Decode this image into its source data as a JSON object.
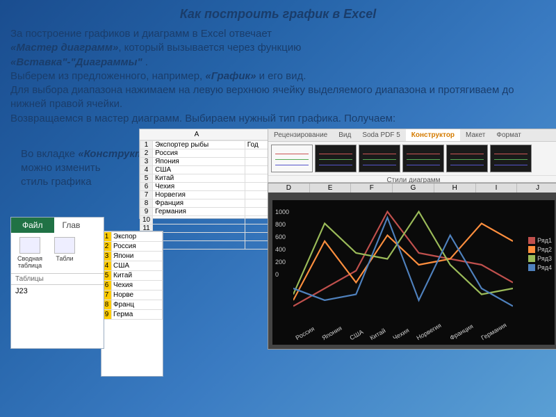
{
  "title": "Как построить график в Excel",
  "intro": {
    "p1_a": "За построение графиков и диаграмм в Excel отвечает",
    "p1_b": "«Мастер диаграмм»",
    "p1_c": ", который вызывается через функцию",
    "p2": "«Вставка\"-\"Диаграммы\"",
    "p2_dot": " .",
    "p3_a": "Выберем из предложенного, например, ",
    "p3_b": "«График»",
    "p3_c": " и его вид.",
    "p4": "Для выбора диапазона нажимаем на левую верхнюю ячейку выделяемого диапазона и протягиваем до нижней правой ячейки.",
    "p5": "Возвращаемся в мастер диаграмм. Выбираем нужный тип графика. Получаем:"
  },
  "overlay": {
    "a": "Во вкладке ",
    "b": "«Конструктор»",
    "c": "можно изменить",
    "d": "стиль графика"
  },
  "excel1": {
    "file": "Файл",
    "home": "Глав",
    "tool1": "Сводная таблица",
    "tool2": "Табли",
    "section": "Таблицы",
    "cell": "J23"
  },
  "excel2": {
    "hdr": "Экспор",
    "rows": [
      "Россия",
      "Япони",
      "США",
      "Китай",
      "Чехия",
      "Норве",
      "Франц",
      "Герма"
    ]
  },
  "excel3": {
    "colA_header": "A",
    "colA_label": "Экспортер рыбы",
    "colB_label": "Год",
    "rows": [
      "Россия",
      "Япония",
      "США",
      "Китай",
      "Чехия",
      "Норвегия",
      "Франция",
      "Германия"
    ]
  },
  "ribbon": {
    "tabs": [
      "Рецензирование",
      "Вид",
      "Soda PDF 5",
      "Конструктор",
      "Макет",
      "Формат"
    ],
    "caption": "Стили диаграмм"
  },
  "chart_data": {
    "type": "line",
    "categories": [
      "Россия",
      "Япония",
      "США",
      "Китай",
      "Чехия",
      "Норвегия",
      "Франция",
      "Германия"
    ],
    "series": [
      {
        "name": "Ряд1",
        "color": "#c0504d",
        "values": [
          150,
          300,
          450,
          950,
          600,
          550,
          500,
          350
        ]
      },
      {
        "name": "Ряд2",
        "color": "#ff8f3e",
        "values": [
          200,
          700,
          350,
          750,
          500,
          550,
          850,
          700
        ]
      },
      {
        "name": "Ряд3",
        "color": "#9bbb59",
        "values": [
          250,
          850,
          600,
          550,
          950,
          500,
          250,
          300
        ]
      },
      {
        "name": "Ряд4",
        "color": "#4f81bd",
        "values": [
          300,
          200,
          250,
          900,
          200,
          750,
          300,
          150
        ]
      }
    ],
    "ylim": [
      0,
      1000
    ],
    "yticks": [
      0,
      200,
      400,
      600,
      800,
      1000
    ],
    "cols": [
      "D",
      "E",
      "F",
      "G",
      "H",
      "I",
      "J"
    ]
  }
}
